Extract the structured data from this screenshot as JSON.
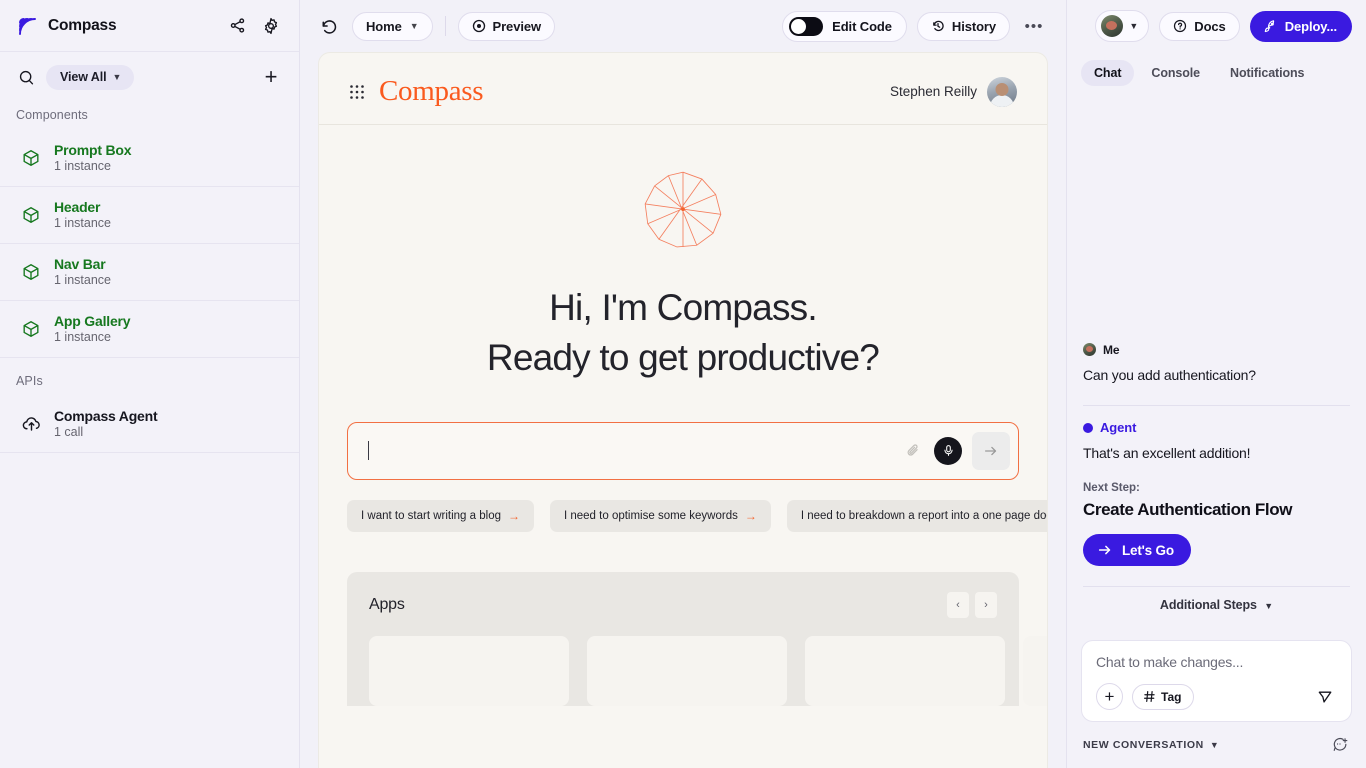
{
  "sidebar": {
    "brand": "Compass",
    "icons": {
      "share": "share-icon",
      "settings": "gear-icon",
      "search": "search-icon",
      "add": "plus-icon"
    },
    "filter_label": "View All",
    "sections": [
      {
        "label": "Components",
        "items": [
          {
            "title": "Prompt Box",
            "sub": "1 instance",
            "icon": "cube-icon"
          },
          {
            "title": "Header",
            "sub": "1 instance",
            "icon": "cube-icon"
          },
          {
            "title": "Nav Bar",
            "sub": "1 instance",
            "icon": "cube-icon"
          },
          {
            "title": "App Gallery",
            "sub": "1 instance",
            "icon": "cube-icon"
          }
        ]
      },
      {
        "label": "APIs",
        "items": [
          {
            "title": "Compass Agent",
            "sub": "1 call",
            "icon": "api-cloud-icon"
          }
        ]
      }
    ]
  },
  "toolbar": {
    "undo_icon": "undo-icon",
    "page_label": "Home",
    "preview_label": "Preview",
    "edit_code_label": "Edit Code",
    "edit_code_enabled": false,
    "history_label": "History",
    "more_label": "•••"
  },
  "account": {
    "chevron": "chevron-down-icon",
    "docs_label": "Docs",
    "deploy_label": "Deploy..."
  },
  "preview": {
    "brand": "Compass",
    "user_name": "Stephen Reilly",
    "hero_line1": "Hi, I'm Compass.",
    "hero_line2": "Ready to get productive?",
    "prompt_placeholder": "",
    "chips": [
      "I want to start writing  a blog",
      "I need to optimise some keywords",
      "I need to breakdown a report into a one page document"
    ],
    "apps": {
      "title": "Apps",
      "prev": "‹",
      "next": "›",
      "cards": [
        "",
        "",
        "",
        ""
      ]
    }
  },
  "rightpanel": {
    "tabs": [
      {
        "label": "Chat",
        "active": true
      },
      {
        "label": "Console",
        "active": false
      },
      {
        "label": "Notifications",
        "active": false
      }
    ],
    "messages": [
      {
        "author": "Me",
        "text": "Can you add authentication?",
        "kind": "user"
      },
      {
        "author": "Agent",
        "text": "That's an excellent addition!",
        "kind": "agent"
      }
    ],
    "next_step_label": "Next Step:",
    "next_step_title": "Create Authentication Flow",
    "lets_go_label": "Let's Go",
    "additional_steps_label": "Additional Steps",
    "composer": {
      "placeholder": "Chat to make changes...",
      "plus": "+",
      "tag_label": "Tag"
    },
    "footer": {
      "new_conversation_label": "NEW CONVERSATION"
    }
  },
  "colors": {
    "accent_blue": "#3a1ae0",
    "accent_orange": "#fa5a1e",
    "component_green": "#16781f",
    "sidebar_bg": "#f3f2f9",
    "canvas_bg": "#f8f6f2"
  }
}
